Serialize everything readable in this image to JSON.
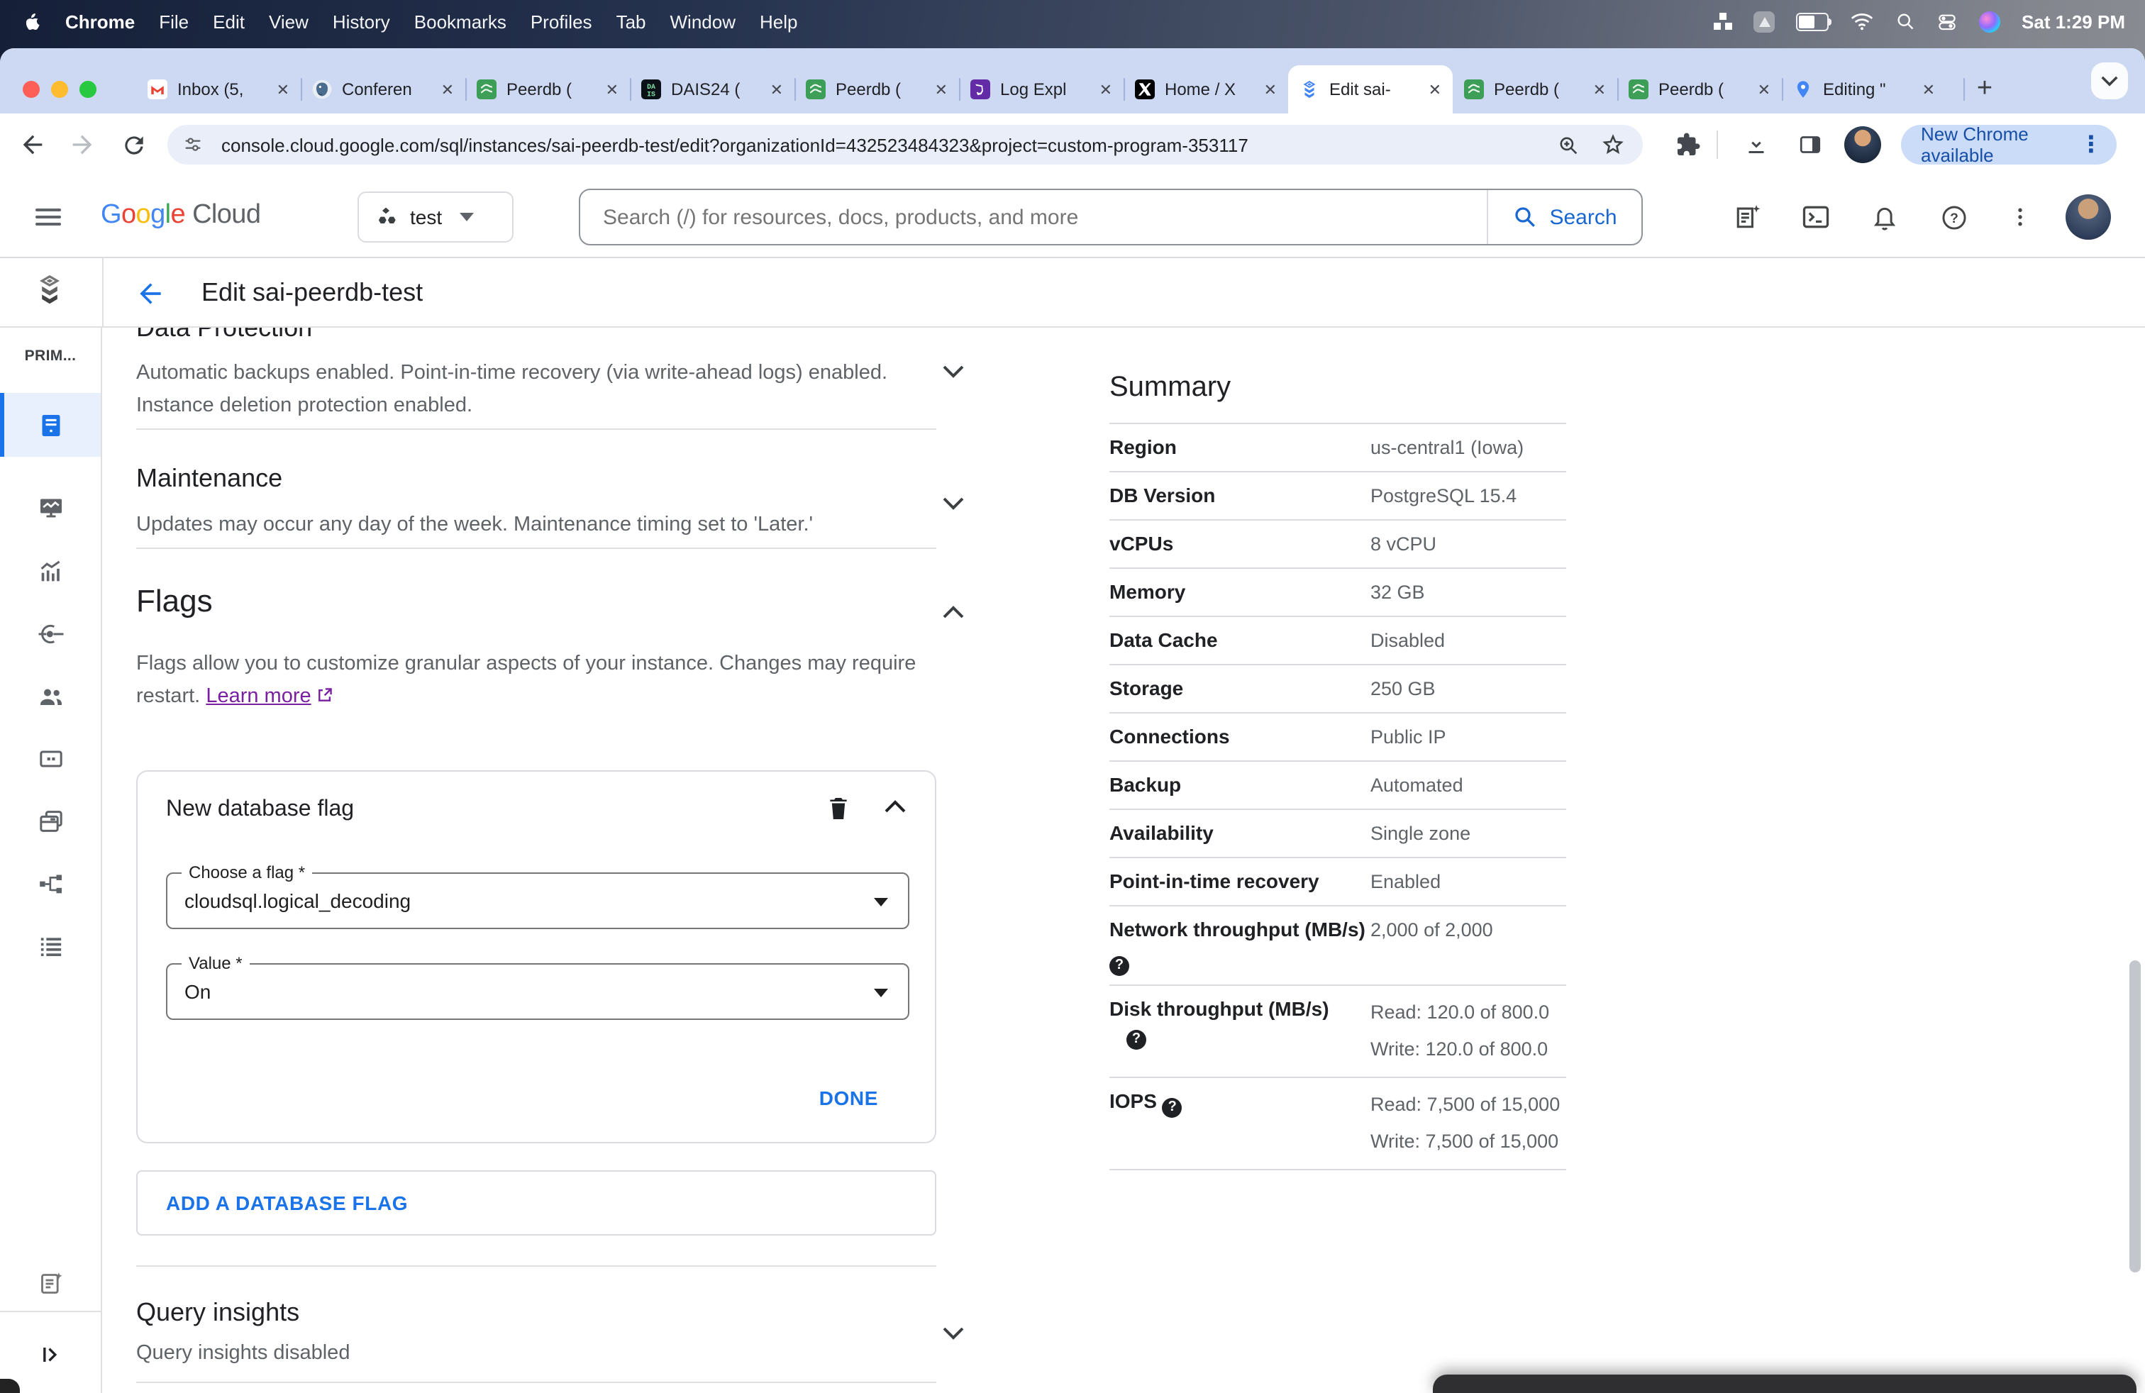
{
  "menubar": {
    "app_name": "Chrome",
    "items": [
      "File",
      "Edit",
      "View",
      "History",
      "Bookmarks",
      "Profiles",
      "Tab",
      "Window",
      "Help"
    ],
    "clock": "Sat 1:29 PM"
  },
  "tabbar": {
    "tabs": [
      {
        "title": "Inbox (5,",
        "favicon": "gmail"
      },
      {
        "title": "Conferen",
        "favicon": "postgresql"
      },
      {
        "title": "Peerdb (",
        "favicon": "peerdb"
      },
      {
        "title": "DAIS24 (",
        "favicon": "dais"
      },
      {
        "title": "Peerdb (",
        "favicon": "peerdb"
      },
      {
        "title": "Log Expl",
        "favicon": "datadog"
      },
      {
        "title": "Home / X",
        "favicon": "x"
      },
      {
        "title": "Edit sai-",
        "favicon": "cloudsql",
        "active": true
      },
      {
        "title": "Peerdb (",
        "favicon": "peerdb"
      },
      {
        "title": "Peerdb (",
        "favicon": "peerdb"
      },
      {
        "title": "Editing \"",
        "favicon": "maps"
      }
    ],
    "new_tab": "+"
  },
  "toolbar": {
    "url": "console.cloud.google.com/sql/instances/sai-peerdb-test/edit?organizationId=432523484323&project=custom-program-353117",
    "update_button": "New Chrome available"
  },
  "gcp_header": {
    "logo_letters": [
      "G",
      "o",
      "o",
      "g",
      "l",
      "e"
    ],
    "logo_cloud": "Cloud",
    "project_name": "test",
    "search_placeholder": "Search (/) for resources, docs, products, and more",
    "search_button": "Search"
  },
  "sidebar": {
    "section_label": "PRIM..."
  },
  "page": {
    "title": "Edit sai-peerdb-test"
  },
  "sections": {
    "data_protection": {
      "title": "Data Protection",
      "line1": "Automatic backups enabled. Point-in-time recovery (via write-ahead logs) enabled.",
      "line2": "Instance deletion protection enabled."
    },
    "maintenance": {
      "title": "Maintenance",
      "desc": "Updates may occur any day of the week. Maintenance timing set to 'Later.'"
    },
    "flags": {
      "title": "Flags",
      "desc": "Flags allow you to customize granular aspects of your instance. Changes may require restart.",
      "link": "Learn more"
    },
    "query_insights": {
      "title": "Query insights",
      "desc": "Query insights disabled"
    }
  },
  "flag_card": {
    "title": "New database flag",
    "flag_label": "Choose a flag *",
    "flag_value": "cloudsql.logical_decoding",
    "value_label": "Value *",
    "value_value": "On",
    "done": "DONE"
  },
  "add_flag_label": "ADD A DATABASE FLAG",
  "summary": {
    "title": "Summary",
    "rows": [
      {
        "label": "Region",
        "value": "us-central1 (Iowa)"
      },
      {
        "label": "DB Version",
        "value": "PostgreSQL 15.4"
      },
      {
        "label": "vCPUs",
        "value": "8 vCPU"
      },
      {
        "label": "Memory",
        "value": "32 GB"
      },
      {
        "label": "Data Cache",
        "value": "Disabled"
      },
      {
        "label": "Storage",
        "value": "250 GB"
      },
      {
        "label": "Connections",
        "value": "Public IP"
      },
      {
        "label": "Backup",
        "value": "Automated"
      },
      {
        "label": "Availability",
        "value": "Single zone"
      },
      {
        "label": "Point-in-time recovery",
        "value": "Enabled"
      },
      {
        "label": "Network throughput (MB/s)",
        "value": "2,000 of 2,000"
      },
      {
        "label": "Disk throughput (MB/s)",
        "value": "Read: 120.0 of 800.0",
        "value2": "Write: 120.0 of 800.0"
      },
      {
        "label": "IOPS",
        "value": "Read: 7,500 of 15,000",
        "value2": "Write: 7,500 of 15,000"
      }
    ]
  },
  "colors": {
    "accent_blue": "#1a73e8",
    "search_blue": "#1967d2",
    "link_purple": "#7b1fa2",
    "tabstrip_bg": "#cdd9f3",
    "active_nav_bg": "#e8f0fe",
    "update_pill_bg": "#cbdcf8"
  },
  "icons": [
    "apple-icon",
    "wifi-icon",
    "battery-icon",
    "spotlight-icon",
    "control-center-icon",
    "siri-icon",
    "gmail-favicon",
    "postgresql-favicon",
    "peerdb-favicon",
    "dais-favicon",
    "datadog-favicon",
    "x-favicon",
    "cloudsql-favicon",
    "maps-favicon",
    "back-icon",
    "forward-icon",
    "reload-icon",
    "site-settings-icon",
    "zoom-in-icon",
    "bookmark-star-icon",
    "extensions-icon",
    "download-icon",
    "side-panel-icon",
    "more-vertical-icon",
    "hamburger-icon",
    "organization-icon",
    "search-icon",
    "release-notes-icon",
    "cloud-shell-icon",
    "bell-icon",
    "help-icon",
    "cloudsql-logo-icon",
    "overview-icon",
    "monitor-icon",
    "insights-icon",
    "connections-icon",
    "users-icon",
    "databases-icon",
    "backups-icon",
    "replicas-icon",
    "operations-icon",
    "expand-panel-icon",
    "trash-icon",
    "chevron-down-icon",
    "chevron-up-icon",
    "question-icon",
    "external-link-icon"
  ]
}
